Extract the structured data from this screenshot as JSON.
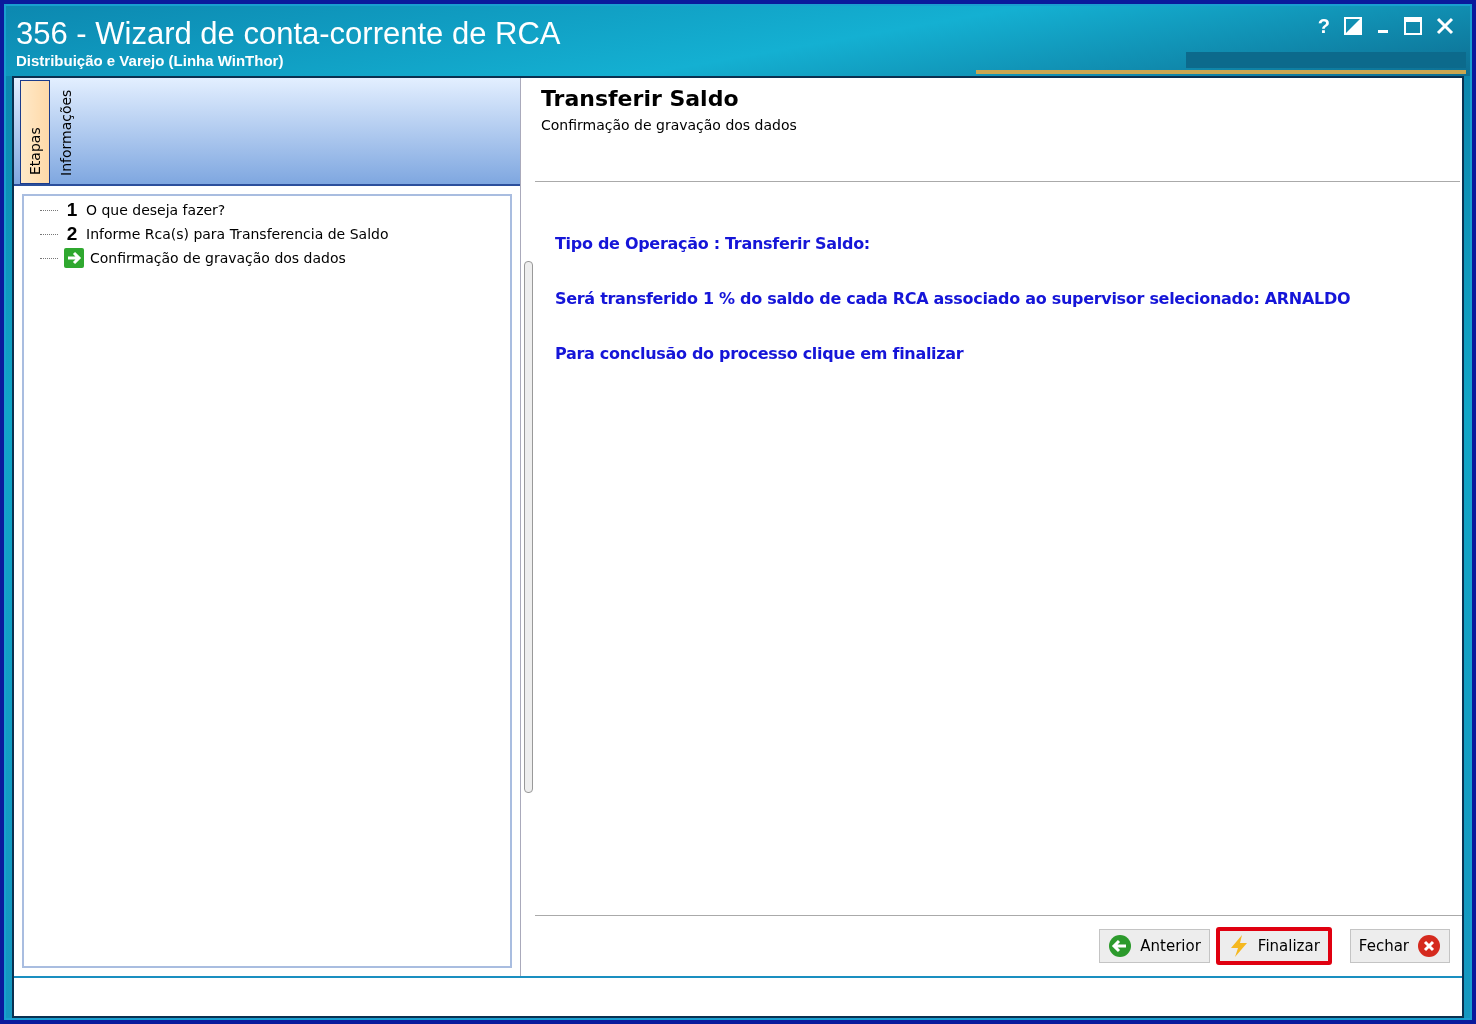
{
  "window": {
    "title": "356 - Wizard de conta-corrente de RCA",
    "subtitle": "Distribuição e Varejo (Linha WinThor)",
    "controls": [
      {
        "kind": "help",
        "label": "?"
      },
      {
        "kind": "restore"
      },
      {
        "kind": "minimize"
      },
      {
        "kind": "maximize"
      },
      {
        "kind": "close"
      }
    ]
  },
  "side_tabs": [
    {
      "label": "Etapas",
      "selected": true
    },
    {
      "label": "Informações",
      "selected": false
    }
  ],
  "steps": [
    {
      "kind": "number",
      "number": "1",
      "label": "O que deseja fazer?"
    },
    {
      "kind": "number",
      "number": "2",
      "label": "Informe Rca(s) para Transferencia de Saldo"
    },
    {
      "kind": "current",
      "label": "Confirmação de gravação dos dados"
    }
  ],
  "header": {
    "title": "Transferir Saldo",
    "subtitle": "Confirmação de gravação dos dados"
  },
  "messages": [
    "Tipo de Operação : Transferir Saldo:",
    "Será transferido 1 % do saldo de cada RCA associado ao supervisor selecionado: ARNALDO",
    "Para conclusão do processo clique em finalizar"
  ],
  "buttons": [
    {
      "kind": "back",
      "label": "Anterior",
      "highlighted": false
    },
    {
      "kind": "finish",
      "label": "Finalizar",
      "highlighted": true
    },
    {
      "kind": "close",
      "label": "Fechar",
      "highlighted": false
    }
  ]
}
